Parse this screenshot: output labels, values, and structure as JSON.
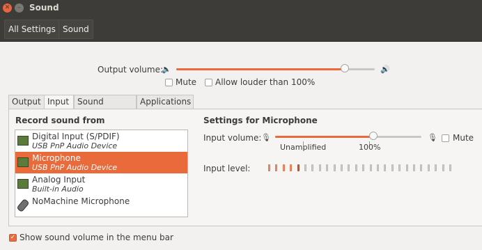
{
  "window": {
    "title": "Sound"
  },
  "toolbar": {
    "all_settings": "All Settings",
    "sound": "Sound"
  },
  "output": {
    "volume_label": "Output volume:",
    "volume_fraction": 0.85,
    "mute_label": "Mute",
    "mute_checked": false,
    "louder_label": "Allow louder than 100%",
    "louder_checked": false
  },
  "tabs": [
    {
      "label": "Output",
      "active": false
    },
    {
      "label": "Input",
      "active": true
    },
    {
      "label": "Sound Effects",
      "active": false
    },
    {
      "label": "Applications",
      "active": false
    }
  ],
  "record": {
    "heading": "Record sound from",
    "devices": [
      {
        "name": "Digital Input (S/PDIF)",
        "sub": "USB PnP Audio Device",
        "icon": "sound-card-icon",
        "selected": false
      },
      {
        "name": "Microphone",
        "sub": "USB PnP Audio Device",
        "icon": "sound-card-icon",
        "selected": true
      },
      {
        "name": "Analog Input",
        "sub": "Built-in Audio",
        "icon": "sound-card-icon",
        "selected": false
      },
      {
        "name": "NoMachine Microphone",
        "sub": "",
        "icon": "microphone-icon",
        "selected": false
      }
    ]
  },
  "settings": {
    "heading": "Settings for Microphone",
    "input_volume_label": "Input volume:",
    "input_volume_fraction": 0.67,
    "unamplified_label": "Unamplified",
    "hundred_label": "100%",
    "mute_label": "Mute",
    "mute_checked": false,
    "input_level_label": "Input level:",
    "level_segments_total": 26,
    "level_segments_on": 5
  },
  "footer": {
    "show_volume_label": "Show sound volume in the menu bar",
    "show_volume_checked": true
  },
  "colors": {
    "accent": "#e96b3c",
    "titlebar": "#3d3c38"
  }
}
